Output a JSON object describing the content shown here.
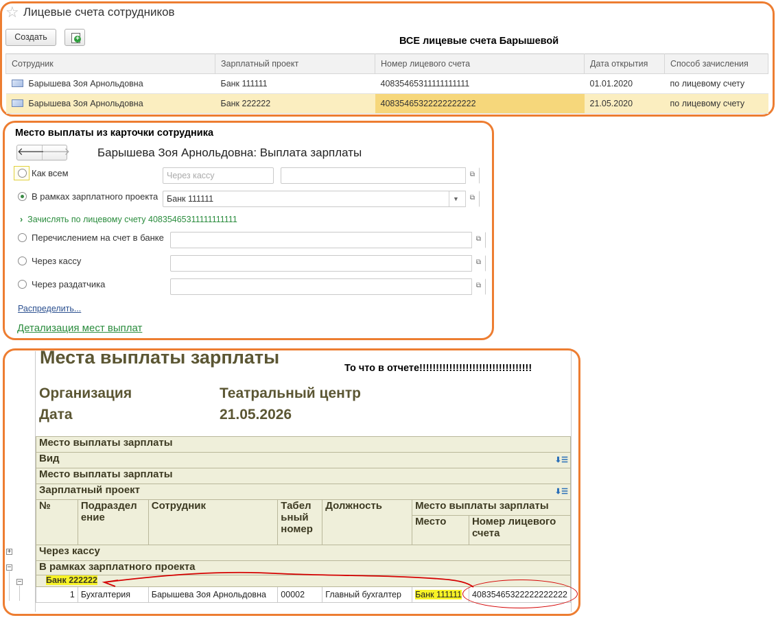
{
  "section1": {
    "title": "Лицевые счета сотрудников",
    "create_label": "Создать",
    "annotation": "ВСЕ лицевые счета Барышевой",
    "columns": [
      "Сотрудник",
      "Зарплатный проект",
      "Номер лицевого счета",
      "Дата открытия",
      "Способ зачисления"
    ],
    "rows": [
      [
        "Барышева Зоя Арнольдовна",
        "Банк 111111",
        "40835465311111111111",
        "01.01.2020",
        "по лицевому счету"
      ],
      [
        "Барышева Зоя Арнольдовна",
        "Банк 222222",
        "40835465322222222222",
        "21.05.2020",
        "по лицевому счету"
      ]
    ]
  },
  "section2": {
    "annotation": "Место выплаты из карточки сотрудника",
    "title": "Барышева Зоя Арнольдовна: Выплата зарплаты",
    "opt_as_all": "Как всем",
    "as_all_placeholder": "Через кассу",
    "opt_salary_project": "В рамках зарплатного проекта",
    "salary_project_value": "Банк 111111",
    "account_line": "Зачислять по лицевому счету 40835465311111111111",
    "opt_bank_transfer": "Перечислением на счет в банке",
    "opt_cash": "Через кассу",
    "opt_distributor": "Через раздатчика",
    "distribute_link": "Распределить...",
    "details_link": "Детализация мест выплат"
  },
  "section3": {
    "title": "Места выплаты зарплаты",
    "annotation": "То что в отчете!!!!!!!!!!!!!!!!!!!!!!!!!!!!!!!!!!",
    "org_label": "Организация",
    "org_value": "Театральный центр",
    "date_label": "Дата",
    "date_value": "21.05.2026",
    "grp1": "Место выплаты зарплаты",
    "grp2": "Вид",
    "grp3": "Место выплаты зарплаты",
    "grp4": "Зарплатный проект",
    "col_no": "№",
    "col_dept": "Подраздел ение",
    "col_emp": "Сотрудник",
    "col_tab": "Табел ьный номер",
    "col_pos": "Должность",
    "col_place_group": "Место выплаты зарплаты",
    "col_place": "Место",
    "col_account": "Номер лицевого счета",
    "group_cash": "Через кассу",
    "group_project": "В рамках зарплатного проекта",
    "bank_group": "Банк 222222",
    "row": {
      "no": "1",
      "dept": "Бухгалтерия",
      "emp": "Барышева Зоя Арнольдовна",
      "tab": "00002",
      "pos": "Главный бухгалтер",
      "place": "Банк 111111",
      "account": "40835465322222222222"
    }
  },
  "colors": {
    "frame": "#ed7d31",
    "selected_row": "#fbeec0",
    "report_header": "#efefda",
    "report_text": "#5b5633",
    "highlight": "#f7f326",
    "annotation_red": "#d40000"
  }
}
